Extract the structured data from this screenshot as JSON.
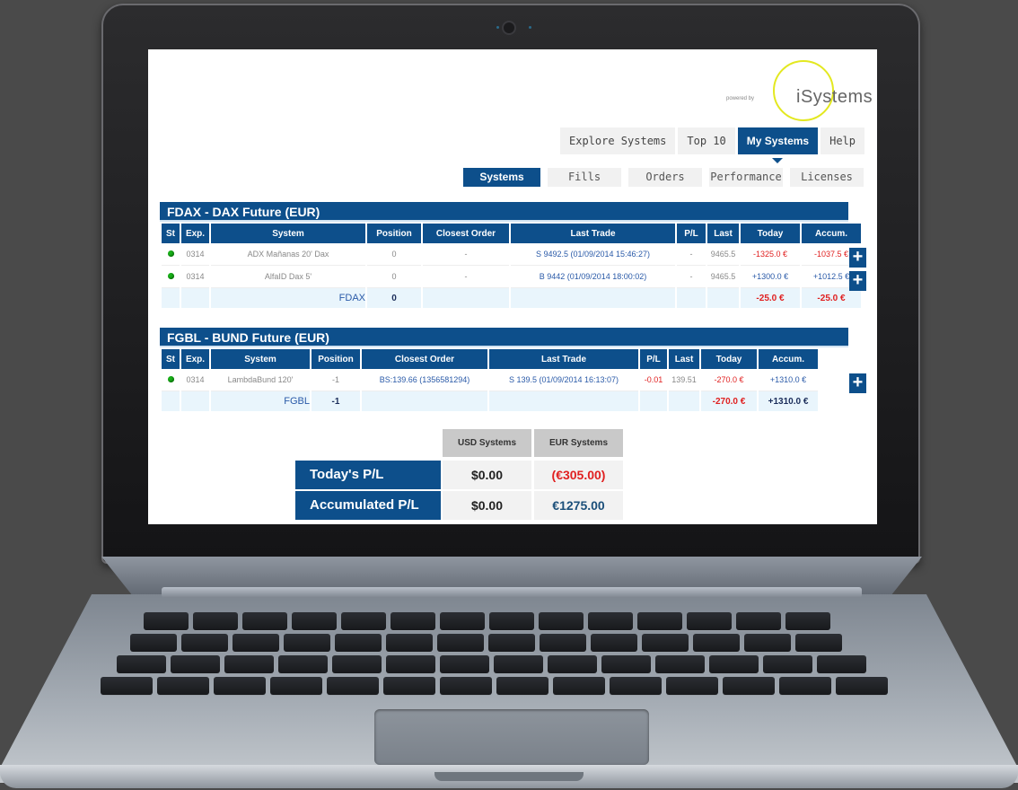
{
  "logo": {
    "powered_by": "powered by",
    "brand": "iSystems"
  },
  "top_nav": {
    "tabs": [
      {
        "label": "Explore Systems",
        "active": false
      },
      {
        "label": "Top 10",
        "active": false
      },
      {
        "label": "My Systems",
        "active": true
      },
      {
        "label": "Help",
        "active": false
      }
    ]
  },
  "sub_nav": {
    "tabs": [
      {
        "label": "Systems",
        "active": true
      },
      {
        "label": "Fills",
        "active": false
      },
      {
        "label": "Orders",
        "active": false
      },
      {
        "label": "Performance",
        "active": false
      },
      {
        "label": "Licenses",
        "active": false
      }
    ]
  },
  "fdax": {
    "title": "FDAX - DAX Future (EUR)",
    "columns": [
      "St",
      "Exp.",
      "System",
      "Position",
      "Closest Order",
      "Last Trade",
      "P/L",
      "Last",
      "Today",
      "Accum."
    ],
    "rows": [
      {
        "status": "green",
        "exp": "0314",
        "system": "ADX Mañanas 20' Dax",
        "position": "0",
        "closest_order": "-",
        "last_trade": "S 9492.5 (01/09/2014 15:46:27)",
        "pl": "-",
        "last": "9465.5",
        "today": "-1325.0 €",
        "accum": "-1037.5 €"
      },
      {
        "status": "green",
        "exp": "0314",
        "system": "AlfaID Dax 5'",
        "position": "0",
        "closest_order": "-",
        "last_trade": "B 9442 (01/09/2014 18:00:02)",
        "pl": "-",
        "last": "9465.5",
        "today": "+1300.0 €",
        "accum": "+1012.5 €"
      }
    ],
    "total": {
      "label": "FDAX",
      "position": "0",
      "today": "-25.0 €",
      "accum": "-25.0 €"
    }
  },
  "fgbl": {
    "title": "FGBL - BUND Future (EUR)",
    "columns": [
      "St",
      "Exp.",
      "System",
      "Position",
      "Closest Order",
      "Last Trade",
      "P/L",
      "Last",
      "Today",
      "Accum."
    ],
    "rows": [
      {
        "status": "green",
        "exp": "0314",
        "system": "LambdaBund 120'",
        "position": "-1",
        "closest_order": "BS:139.66 (1356581294)",
        "last_trade": "S 139.5 (01/09/2014 16:13:07)",
        "pl": "-0.01",
        "last": "139.51",
        "today": "-270.0 €",
        "accum": "+1310.0 €"
      }
    ],
    "total": {
      "label": "FGBL",
      "position": "-1",
      "today": "-270.0 €",
      "accum": "+1310.0 €"
    }
  },
  "add_button_label": "+",
  "summary": {
    "col_usd": "USD Systems",
    "col_eur": "EUR Systems",
    "today_label": "Today's P/L",
    "today_usd": "$0.00",
    "today_eur": "(€305.00)",
    "accum_label": "Accumulated P/L",
    "accum_usd": "$0.00",
    "accum_eur": "€1275.00"
  },
  "colors": {
    "brand_blue": "#0d4f8b",
    "negative_red": "#e02020",
    "positive_green": "#19b219"
  }
}
